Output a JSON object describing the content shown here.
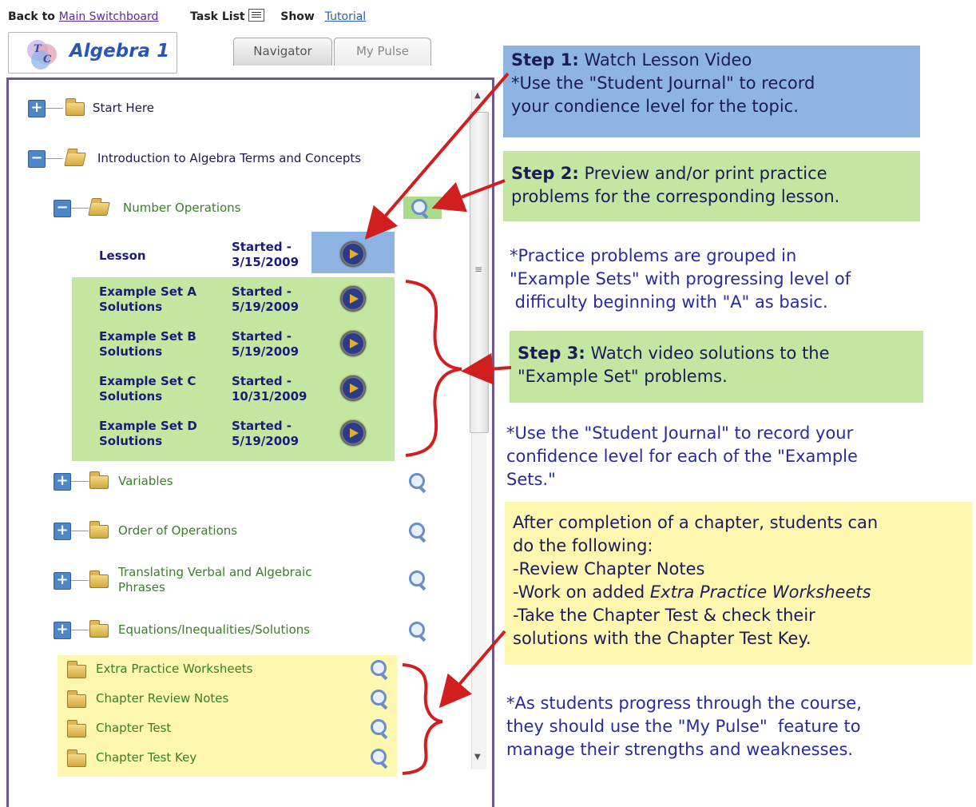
{
  "topbar": {
    "back_prefix": "Back to",
    "back_link": "Main Switchboard",
    "task_list": "Task List",
    "show": "Show",
    "tutorial": "Tutorial"
  },
  "logo": {
    "text": "Algebra 1",
    "badge_letters": "TC"
  },
  "tabs": [
    {
      "label": "Navigator"
    },
    {
      "label": "My Pulse"
    }
  ],
  "tree": {
    "start_here": "Start Here",
    "intro": "Introduction to Algebra Terms and Concepts",
    "number_ops": "Number Operations",
    "lesson": {
      "name": "Lesson",
      "status": "Started -",
      "date": "3/15/2009"
    },
    "example_sets": [
      {
        "name": "Example Set A",
        "sub": "Solutions",
        "status": "Started -",
        "date": "5/19/2009"
      },
      {
        "name": "Example Set B",
        "sub": "Solutions",
        "status": "Started -",
        "date": "5/19/2009"
      },
      {
        "name": "Example Set C",
        "sub": "Solutions",
        "status": "Started -",
        "date": "10/31/2009"
      },
      {
        "name": "Example Set D",
        "sub": "Solutions",
        "status": "Started -",
        "date": "5/19/2009"
      }
    ],
    "topics": [
      "Variables",
      "Order of Operations",
      "Translating Verbal and Algebraic",
      "Phrases",
      "Equations/Inequalities/Solutions"
    ],
    "extras": [
      "Extra Practice Worksheets",
      "Chapter Review Notes",
      "Chapter Test",
      "Chapter Test Key"
    ]
  },
  "callouts": {
    "step1_title": "Step 1:",
    "step1_head": " Watch Lesson Video",
    "step1_line2": "*Use the \"Student Journal\" to record",
    "step1_line3": "your condience level for the topic.",
    "step2_title": "Step 2:",
    "step2_head": " Preview and/or print practice",
    "step2_line2": "problems for the corresponding lesson.",
    "note1_l1": "*Practice problems are grouped in",
    "note1_l2": "\"Example Sets\" with progressing level of",
    "note1_l3": " difficulty beginning with \"A\" as basic.",
    "step3_title": "Step 3:",
    "step3_head": " Watch video solutions to the",
    "step3_line2": "\"Example Set\" problems.",
    "note2_l1": "*Use the \"Student Journal\" to record your",
    "note2_l2": "confidence level for each of the \"Example",
    "note2_l3": "Sets.\"",
    "yellow_l1": "After completion of a chapter, students can",
    "yellow_l2": "do the following:",
    "yellow_l3": "-Review Chapter Notes",
    "yellow_l4a": "-Work on added ",
    "yellow_l4b": "Extra Practice Worksheets",
    "yellow_l5": "-Take the Chapter Test & check their",
    "yellow_l6": "solutions with the Chapter Test Key.",
    "note3_l1": "*As students progress through the course,",
    "note3_l2": "they should use the \"My Pulse\"  feature to",
    "note3_l3": "manage their strengths and weaknesses."
  },
  "colors": {
    "blue_box": "#8eb4e3",
    "green_box": "#c3e6a0",
    "yellow_box": "#fdf7b0",
    "arrow": "#d11f1f"
  }
}
